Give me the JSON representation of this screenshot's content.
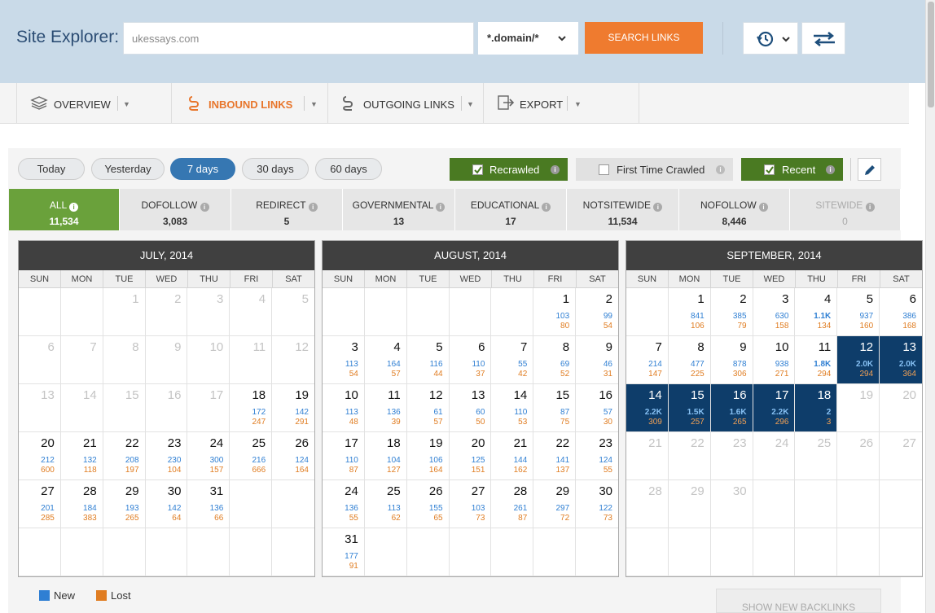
{
  "header": {
    "title": "Site Explorer:",
    "search_value": "ukessays.com",
    "mode": "*.domain/*",
    "search_button": "SEARCH LINKS",
    "history_icon": "history-icon",
    "swap_icon": "swap-arrows-icon"
  },
  "tabs": [
    {
      "label": "OVERVIEW",
      "icon": "layers-icon"
    },
    {
      "label": "INBOUND LINKS",
      "icon": "inbound-link-icon",
      "active": true
    },
    {
      "label": "OUTGOING LINKS",
      "icon": "outgoing-link-icon"
    },
    {
      "label": "EXPORT",
      "icon": "export-icon"
    }
  ],
  "ranges": [
    "Today",
    "Yesterday",
    "7 days",
    "30 days",
    "60 days"
  ],
  "active_range": "7 days",
  "filters": {
    "recrawled": "Recrawled",
    "first_time": "First Time Crawled",
    "recent": "Recent"
  },
  "stats": [
    {
      "label": "ALL",
      "value": "11,534",
      "active": true
    },
    {
      "label": "DOFOLLOW",
      "value": "3,083"
    },
    {
      "label": "REDIRECT",
      "value": "5"
    },
    {
      "label": "GOVERNMENTAL",
      "value": "13"
    },
    {
      "label": "EDUCATIONAL",
      "value": "17"
    },
    {
      "label": "NOTSITEWIDE",
      "value": "11,534"
    },
    {
      "label": "NOFOLLOW",
      "value": "8,446"
    },
    {
      "label": "SITEWIDE",
      "value": "0",
      "dim": true
    }
  ],
  "weekdays": [
    "SUN",
    "MON",
    "TUE",
    "WED",
    "THU",
    "FRI",
    "SAT"
  ],
  "calendars": [
    {
      "title": "JULY, 2014",
      "cells": [
        {
          "d": ""
        },
        {
          "d": ""
        },
        {
          "d": "1",
          "o": 1
        },
        {
          "d": "2",
          "o": 1
        },
        {
          "d": "3",
          "o": 1
        },
        {
          "d": "4",
          "o": 1
        },
        {
          "d": "5",
          "o": 1
        },
        {
          "d": "6",
          "o": 1
        },
        {
          "d": "7",
          "o": 1
        },
        {
          "d": "8",
          "o": 1
        },
        {
          "d": "9",
          "o": 1
        },
        {
          "d": "10",
          "o": 1
        },
        {
          "d": "11",
          "o": 1
        },
        {
          "d": "12",
          "o": 1
        },
        {
          "d": "13",
          "o": 1
        },
        {
          "d": "14",
          "o": 1
        },
        {
          "d": "15",
          "o": 1
        },
        {
          "d": "16",
          "o": 1
        },
        {
          "d": "17",
          "o": 1
        },
        {
          "d": "18",
          "n": "172",
          "l": "247"
        },
        {
          "d": "19",
          "n": "142",
          "l": "291"
        },
        {
          "d": "20",
          "n": "212",
          "l": "600"
        },
        {
          "d": "21",
          "n": "132",
          "l": "118"
        },
        {
          "d": "22",
          "n": "208",
          "l": "197"
        },
        {
          "d": "23",
          "n": "230",
          "l": "104"
        },
        {
          "d": "24",
          "n": "300",
          "l": "157"
        },
        {
          "d": "25",
          "n": "216",
          "l": "666"
        },
        {
          "d": "26",
          "n": "124",
          "l": "164"
        },
        {
          "d": "27",
          "n": "201",
          "l": "285"
        },
        {
          "d": "28",
          "n": "184",
          "l": "383"
        },
        {
          "d": "29",
          "n": "193",
          "l": "265"
        },
        {
          "d": "30",
          "n": "142",
          "l": "64"
        },
        {
          "d": "31",
          "n": "136",
          "l": "66"
        },
        {
          "d": ""
        },
        {
          "d": ""
        },
        {
          "d": ""
        },
        {
          "d": ""
        },
        {
          "d": ""
        },
        {
          "d": ""
        },
        {
          "d": ""
        },
        {
          "d": ""
        },
        {
          "d": ""
        }
      ]
    },
    {
      "title": "AUGUST, 2014",
      "cells": [
        {
          "d": ""
        },
        {
          "d": ""
        },
        {
          "d": ""
        },
        {
          "d": ""
        },
        {
          "d": ""
        },
        {
          "d": "1",
          "n": "103",
          "l": "80"
        },
        {
          "d": "2",
          "n": "99",
          "l": "54"
        },
        {
          "d": "3",
          "n": "113",
          "l": "54"
        },
        {
          "d": "4",
          "n": "164",
          "l": "57"
        },
        {
          "d": "5",
          "n": "116",
          "l": "44"
        },
        {
          "d": "6",
          "n": "110",
          "l": "37"
        },
        {
          "d": "7",
          "n": "55",
          "l": "42"
        },
        {
          "d": "8",
          "n": "69",
          "l": "52"
        },
        {
          "d": "9",
          "n": "46",
          "l": "31"
        },
        {
          "d": "10",
          "n": "113",
          "l": "48"
        },
        {
          "d": "11",
          "n": "136",
          "l": "39"
        },
        {
          "d": "12",
          "n": "61",
          "l": "57"
        },
        {
          "d": "13",
          "n": "60",
          "l": "50"
        },
        {
          "d": "14",
          "n": "110",
          "l": "53"
        },
        {
          "d": "15",
          "n": "87",
          "l": "75"
        },
        {
          "d": "16",
          "n": "57",
          "l": "30"
        },
        {
          "d": "17",
          "n": "110",
          "l": "87"
        },
        {
          "d": "18",
          "n": "104",
          "l": "127"
        },
        {
          "d": "19",
          "n": "106",
          "l": "164"
        },
        {
          "d": "20",
          "n": "125",
          "l": "151"
        },
        {
          "d": "21",
          "n": "144",
          "l": "162"
        },
        {
          "d": "22",
          "n": "141",
          "l": "137"
        },
        {
          "d": "23",
          "n": "124",
          "l": "55"
        },
        {
          "d": "24",
          "n": "136",
          "l": "55"
        },
        {
          "d": "25",
          "n": "113",
          "l": "62"
        },
        {
          "d": "26",
          "n": "155",
          "l": "65"
        },
        {
          "d": "27",
          "n": "103",
          "l": "73"
        },
        {
          "d": "28",
          "n": "261",
          "l": "87"
        },
        {
          "d": "29",
          "n": "297",
          "l": "72"
        },
        {
          "d": "30",
          "n": "122",
          "l": "73"
        },
        {
          "d": "31",
          "n": "177",
          "l": "91"
        },
        {
          "d": ""
        },
        {
          "d": ""
        },
        {
          "d": ""
        },
        {
          "d": ""
        },
        {
          "d": ""
        },
        {
          "d": ""
        }
      ]
    },
    {
      "title": "SEPTEMBER, 2014",
      "cells": [
        {
          "d": ""
        },
        {
          "d": "1",
          "n": "841",
          "l": "106"
        },
        {
          "d": "2",
          "n": "385",
          "l": "79"
        },
        {
          "d": "3",
          "n": "630",
          "l": "158"
        },
        {
          "d": "4",
          "n": "1.1K",
          "l": "134",
          "b": 1
        },
        {
          "d": "5",
          "n": "937",
          "l": "160"
        },
        {
          "d": "6",
          "n": "386",
          "l": "168"
        },
        {
          "d": "7",
          "n": "214",
          "l": "147"
        },
        {
          "d": "8",
          "n": "477",
          "l": "225"
        },
        {
          "d": "9",
          "n": "878",
          "l": "306"
        },
        {
          "d": "10",
          "n": "938",
          "l": "271"
        },
        {
          "d": "11",
          "n": "1.8K",
          "l": "294",
          "b": 1
        },
        {
          "d": "12",
          "n": "2.0K",
          "l": "294",
          "s": 1
        },
        {
          "d": "13",
          "n": "2.0K",
          "l": "364",
          "s": 1
        },
        {
          "d": "14",
          "n": "2.2K",
          "l": "309",
          "s": 1
        },
        {
          "d": "15",
          "n": "1.5K",
          "l": "257",
          "s": 1
        },
        {
          "d": "16",
          "n": "1.6K",
          "l": "265",
          "s": 1
        },
        {
          "d": "17",
          "n": "2.2K",
          "l": "296",
          "s": 1
        },
        {
          "d": "18",
          "n": "2",
          "l": "3",
          "s": 1
        },
        {
          "d": "19",
          "o": 1
        },
        {
          "d": "20",
          "o": 1
        },
        {
          "d": "21",
          "o": 1
        },
        {
          "d": "22",
          "o": 1
        },
        {
          "d": "23",
          "o": 1
        },
        {
          "d": "24",
          "o": 1
        },
        {
          "d": "25",
          "o": 1
        },
        {
          "d": "26",
          "o": 1
        },
        {
          "d": "27",
          "o": 1
        },
        {
          "d": "28",
          "o": 1
        },
        {
          "d": "29",
          "o": 1
        },
        {
          "d": "30",
          "o": 1
        },
        {
          "d": ""
        },
        {
          "d": ""
        },
        {
          "d": ""
        },
        {
          "d": ""
        },
        {
          "d": ""
        },
        {
          "d": ""
        },
        {
          "d": ""
        },
        {
          "d": ""
        },
        {
          "d": ""
        },
        {
          "d": ""
        },
        {
          "d": ""
        }
      ]
    }
  ],
  "legend": {
    "new": "New",
    "lost": "Lost",
    "new_color": "#2f7fd3",
    "lost_color": "#e07d22"
  },
  "show_new": "SHOW NEW BACKLINKS"
}
